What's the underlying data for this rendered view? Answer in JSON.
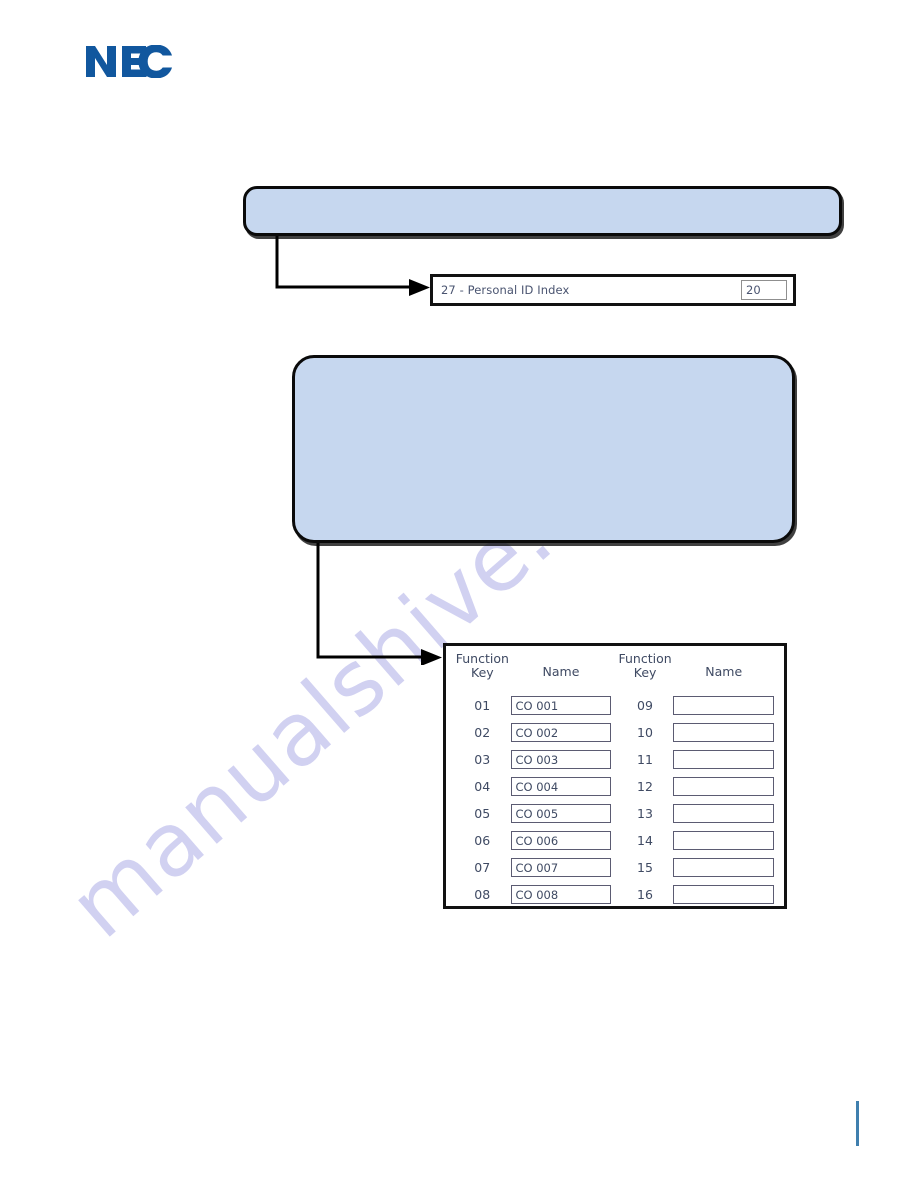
{
  "document": {
    "brand": "NEC",
    "brand_color": "#11579e",
    "background": "#ffffff",
    "watermark": "manualshive.com",
    "watermark_color": "#c9c9ef"
  },
  "callouts": [
    {
      "id": "callout-upper",
      "text": "",
      "fill": "#c6d7ef",
      "border": "#0a0a0a",
      "points_to": "property-row"
    },
    {
      "id": "callout-lower",
      "text": "",
      "fill": "#c6d7ef",
      "border": "#0a0a0a",
      "points_to": "function-key-table"
    }
  ],
  "property_row": {
    "label": "27 - Personal ID Index",
    "value": "20"
  },
  "function_key_table": {
    "headers": {
      "key": "Function\nKey",
      "key_line1": "Function",
      "key_line2": "Key",
      "name": "Name"
    },
    "left_column": [
      {
        "key": "01",
        "name": "CO 001"
      },
      {
        "key": "02",
        "name": "CO 002"
      },
      {
        "key": "03",
        "name": "CO 003"
      },
      {
        "key": "04",
        "name": "CO 004"
      },
      {
        "key": "05",
        "name": "CO 005"
      },
      {
        "key": "06",
        "name": "CO 006"
      },
      {
        "key": "07",
        "name": "CO 007"
      },
      {
        "key": "08",
        "name": "CO 008"
      }
    ],
    "right_column": [
      {
        "key": "09",
        "name": ""
      },
      {
        "key": "10",
        "name": ""
      },
      {
        "key": "11",
        "name": ""
      },
      {
        "key": "12",
        "name": ""
      },
      {
        "key": "13",
        "name": ""
      },
      {
        "key": "14",
        "name": ""
      },
      {
        "key": "15",
        "name": ""
      },
      {
        "key": "16",
        "name": ""
      }
    ]
  },
  "footer": {
    "rule_color": "#3f7fae"
  }
}
